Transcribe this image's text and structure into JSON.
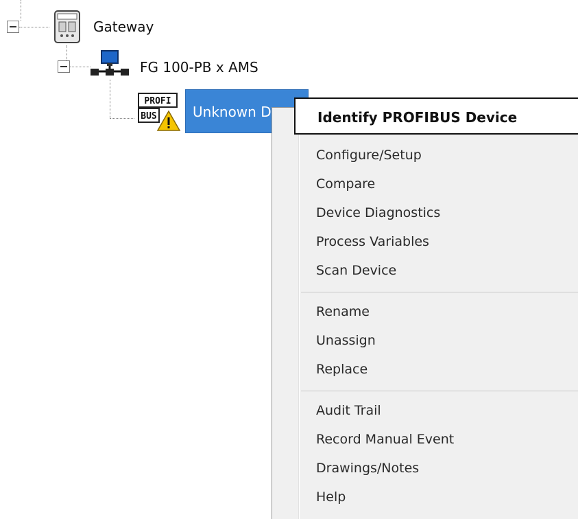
{
  "tree": {
    "root": {
      "label": "Gateway",
      "icon": "gateway-device-icon"
    },
    "child": {
      "label": "FG 100-PB x AMS",
      "icon": "network-computer-icon"
    },
    "leaf": {
      "label": "Unknown Device",
      "label_visible": "Unknown Dev",
      "icon": "profibus-device-icon",
      "badge": "warning-icon",
      "icon_text_top": "PROFI",
      "icon_text_bottom": "BUS"
    }
  },
  "context_menu": {
    "primary": "Identify PROFIBUS Device",
    "group1": [
      "Configure/Setup",
      "Compare",
      "Device Diagnostics",
      "Process Variables",
      "Scan Device"
    ],
    "group2": [
      "Rename",
      "Unassign",
      "Replace"
    ],
    "group3": [
      "Audit Trail",
      "Record Manual Event",
      "Drawings/Notes",
      "Help"
    ]
  },
  "colors": {
    "selection": "#3a85d6",
    "menu_background": "#f0f0f0",
    "warning": "#f5c400"
  }
}
